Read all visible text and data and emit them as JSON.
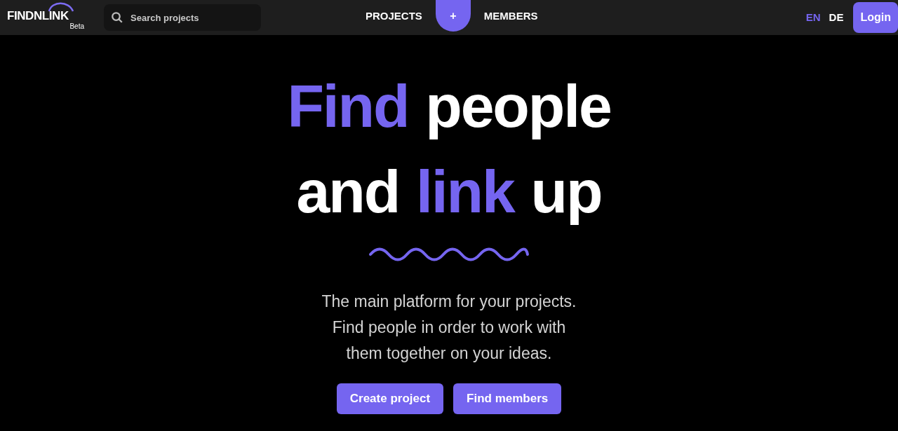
{
  "logo": {
    "text": "FINDNLINK",
    "badge": "Beta"
  },
  "search": {
    "placeholder": "Search projects"
  },
  "nav": [
    {
      "kind": "link",
      "label": "PROJECTS"
    },
    {
      "kind": "add",
      "label": "+"
    },
    {
      "kind": "link",
      "label": "MEMBERS"
    }
  ],
  "languages": [
    {
      "label": "EN",
      "selected": true
    },
    {
      "label": "DE",
      "selected": false
    }
  ],
  "login": "Login",
  "headline": [
    [
      {
        "text": "Find",
        "accent": true
      },
      {
        "text": "people",
        "accent": false
      }
    ],
    [
      {
        "text": "and",
        "accent": false
      },
      {
        "text": "link",
        "accent": true
      },
      {
        "text": "up",
        "accent": false
      }
    ]
  ],
  "subtitle": [
    "The main platform for your projects.",
    "Find people in order to work with",
    "them together on your ideas."
  ],
  "buttons": [
    "Create project",
    "Find members"
  ]
}
